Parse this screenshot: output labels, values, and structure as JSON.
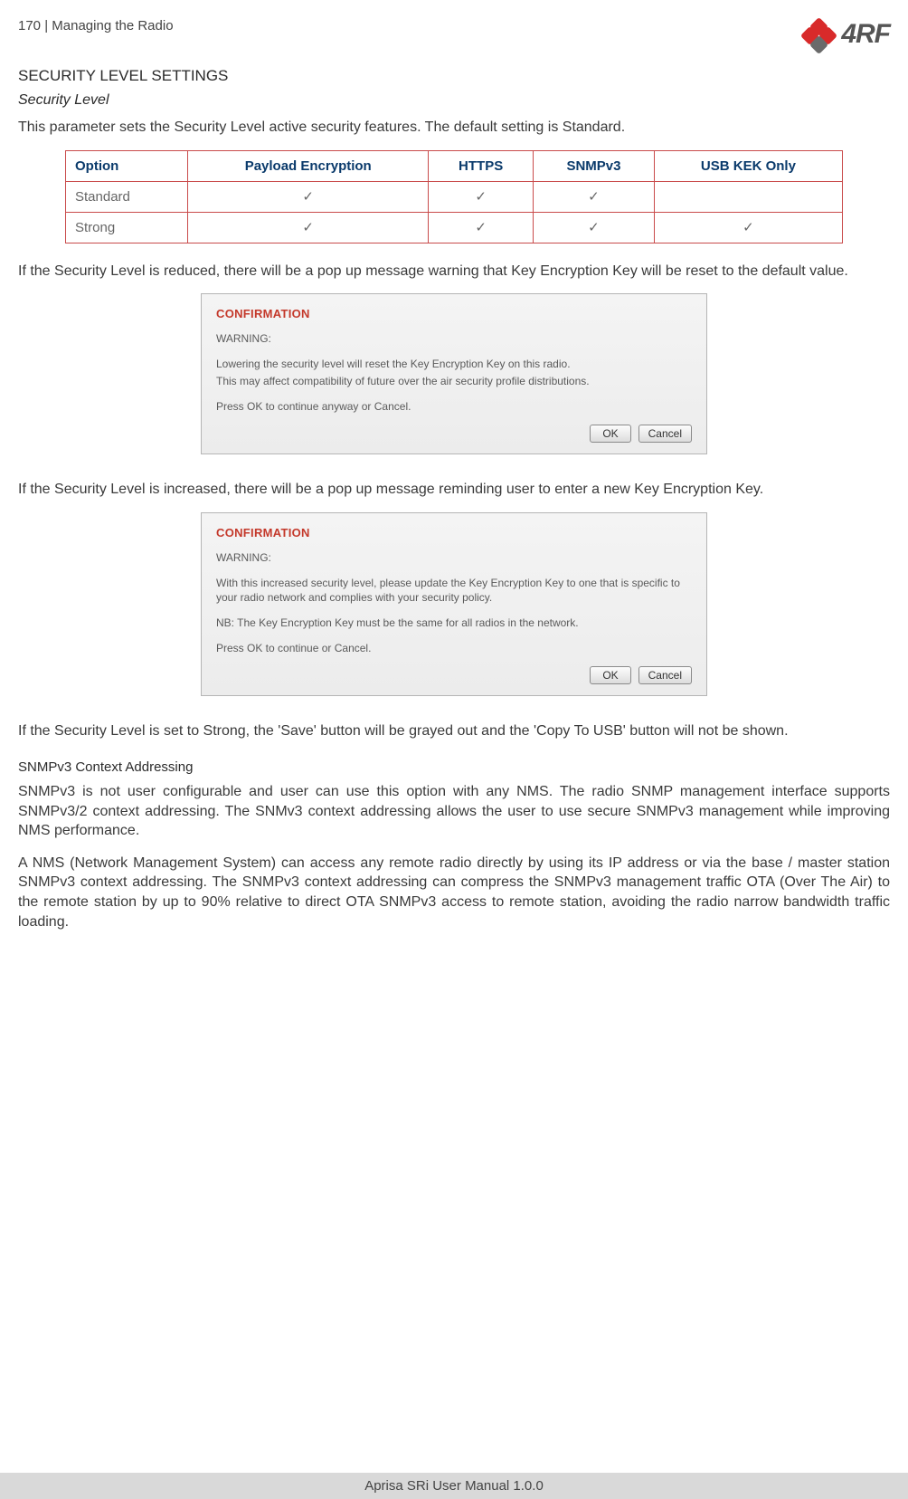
{
  "header": {
    "page_number": "170",
    "section_sep": "|",
    "section_title": "Managing the Radio",
    "brand": "4RF"
  },
  "h1": "SECURITY LEVEL SETTINGS",
  "h2": "Security Level",
  "intro": "This parameter sets the Security Level active security features. The default setting is Standard.",
  "table": {
    "headers": [
      "Option",
      "Payload Encryption",
      "HTTPS",
      "SNMPv3",
      "USB KEK Only"
    ],
    "rows": [
      {
        "option": "Standard",
        "payload": "✓",
        "https": "✓",
        "snmp": "✓",
        "usb": ""
      },
      {
        "option": "Strong",
        "payload": "✓",
        "https": "✓",
        "snmp": "✓",
        "usb": "✓"
      }
    ]
  },
  "para_reduced": "If the Security Level is reduced, there will be a pop up message warning that Key Encryption Key will be reset to the default value.",
  "dialog1": {
    "title": "CONFIRMATION",
    "warning_label": "WARNING:",
    "line1": "Lowering the security level will reset the Key Encryption Key on this radio.",
    "line2": "This may affect compatibility of future over the air security profile distributions.",
    "line3": "Press OK to continue anyway or Cancel.",
    "ok": "OK",
    "cancel": "Cancel"
  },
  "para_increased": "If the Security Level is increased, there will be a pop up message reminding user to enter a new Key Encryption Key.",
  "dialog2": {
    "title": "CONFIRMATION",
    "warning_label": "WARNING:",
    "line1": "With this increased security level, please update the Key Encryption Key to one that is specific to your radio network and complies with your security policy.",
    "line2": "NB: The Key Encryption Key must be the same for all radios in the network.",
    "line3": "Press OK to continue or Cancel.",
    "ok": "OK",
    "cancel": "Cancel"
  },
  "para_strong": "If the Security Level is set to Strong, the 'Save' button will be grayed out and the 'Copy To USB' button will not be shown.",
  "snmp": {
    "heading": "SNMPv3 Context Addressing",
    "p1": "SNMPv3 is not user configurable and user can use this option with any NMS. The radio SNMP management interface supports SNMPv3/2 context addressing. The SNMv3 context addressing allows the user to use secure SNMPv3 management while improving NMS performance.",
    "p2": "A NMS (Network Management System) can access any remote radio directly by using its IP address or via the base / master station SNMPv3 context addressing. The SNMPv3 context addressing can compress the SNMPv3 management traffic OTA (Over The Air) to the remote station by up to 90% relative to direct OTA SNMPv3 access to remote station, avoiding the radio narrow bandwidth traffic loading."
  },
  "footer": "Aprisa SRi User Manual 1.0.0"
}
